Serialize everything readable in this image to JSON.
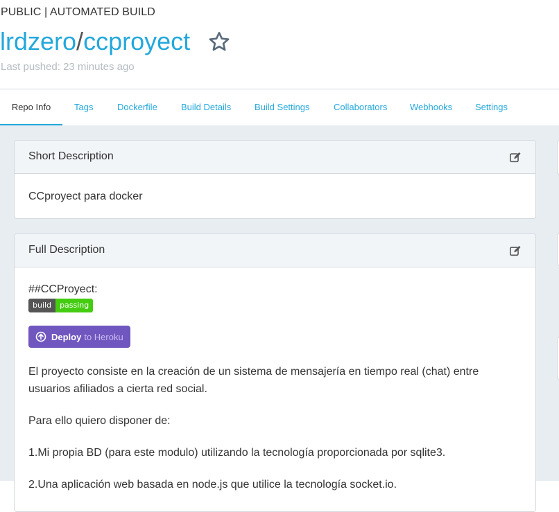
{
  "header": {
    "visibility": "PUBLIC | AUTOMATED BUILD",
    "owner": "lrdzero",
    "separator": "/",
    "repo": "ccproyect",
    "last_pushed": "Last pushed: 23 minutes ago",
    "star_icon": "star-outline-icon"
  },
  "tabs": [
    {
      "label": "Repo Info",
      "active": true
    },
    {
      "label": "Tags"
    },
    {
      "label": "Dockerfile"
    },
    {
      "label": "Build Details"
    },
    {
      "label": "Build Settings"
    },
    {
      "label": "Collaborators"
    },
    {
      "label": "Webhooks"
    },
    {
      "label": "Settings"
    }
  ],
  "short_description": {
    "title": "Short Description",
    "text": "CCproyect para docker",
    "edit_icon": "edit-icon"
  },
  "full_description": {
    "title": "Full Description",
    "edit_icon": "edit-icon",
    "heading": "##CCProyect:",
    "badge": {
      "left": "build",
      "right": "passing"
    },
    "deploy_button": {
      "bold": "Deploy",
      "faded": "to Heroku"
    },
    "paragraphs": [
      "El proyecto consiste en la creación de un sistema de mensajería en tiempo real (chat) entre usuarios afiliados a cierta red social.",
      "Para ello quiero disponer de:",
      "1.Mi propia BD (para este modulo) utilizando la tecnología proporcionada por sqlite3.",
      "2.Una aplicación web basada en node.js que utilice la tecnología socket.io."
    ]
  },
  "colors": {
    "link": "#23a8dc",
    "background": "#e8edf2",
    "heroku": "#7056bf",
    "badge_pass": "#44cc11"
  }
}
